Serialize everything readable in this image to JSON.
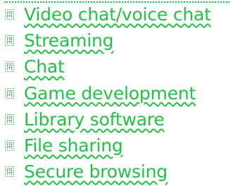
{
  "accent_color": "#23c244",
  "list": {
    "icon": "bitmap-file-icon",
    "items": [
      {
        "label": "Video chat/voice chat"
      },
      {
        "label": "Streaming"
      },
      {
        "label": "Chat"
      },
      {
        "label": "Game development"
      },
      {
        "label": "Library software"
      },
      {
        "label": "File sharing"
      },
      {
        "label": "Secure browsing"
      }
    ]
  }
}
